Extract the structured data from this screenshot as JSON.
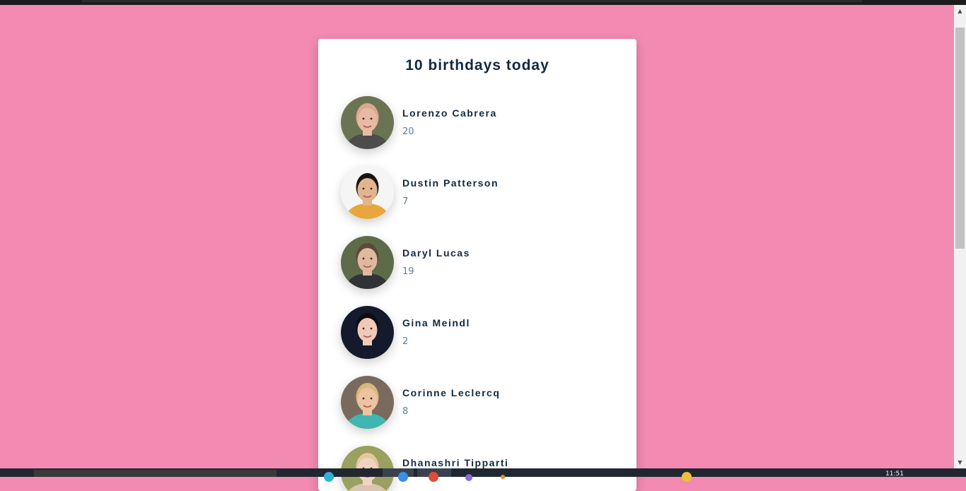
{
  "title": "10 birthdays today",
  "people": [
    {
      "name": "Lorenzo Cabrera",
      "age": "20",
      "avatar_bg": "#6b7452",
      "skin": "#e8b9a5",
      "hair": "#d9a98f",
      "shirt": "#4d4d4d"
    },
    {
      "name": "Dustin Patterson",
      "age": "7",
      "avatar_bg": "#f5f5f5",
      "skin": "#e2b48f",
      "hair": "#1a1410",
      "shirt": "#e8a63c"
    },
    {
      "name": "Daryl Lucas",
      "age": "19",
      "avatar_bg": "#5e6b48",
      "skin": "#e0b8a0",
      "hair": "#5a4a3a",
      "shirt": "#2f3236"
    },
    {
      "name": "Gina Meindl",
      "age": "2",
      "avatar_bg": "#141a2c",
      "skin": "#f0c9b8",
      "hair": "#0c0c12",
      "shirt": "#141a2c"
    },
    {
      "name": "Corinne Leclercq",
      "age": "8",
      "avatar_bg": "#7a6a5e",
      "skin": "#edc3a3",
      "hair": "#d9b97a",
      "shirt": "#3fb6b0"
    },
    {
      "name": "Dhanashri Tipparti",
      "age": "",
      "avatar_bg": "#9aa060",
      "skin": "#f2d2c2",
      "hair": "#e4c89a",
      "shirt": "#d8c6b0"
    }
  ],
  "taskbar": {
    "clock": "11:51"
  }
}
